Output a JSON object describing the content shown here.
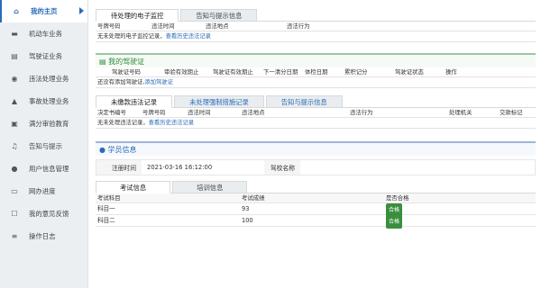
{
  "sidebar": {
    "items": [
      {
        "label": "我的主页",
        "icon": "home-icon",
        "glyph": "⌂",
        "active": true
      },
      {
        "label": "机动车业务",
        "icon": "truck-icon",
        "glyph": "▬"
      },
      {
        "label": "驾驶证业务",
        "icon": "id-card-icon",
        "glyph": "▤"
      },
      {
        "label": "违法处理业务",
        "icon": "camera-icon",
        "glyph": "◉"
      },
      {
        "label": "事故处理业务",
        "icon": "warning-icon",
        "glyph": "▲"
      },
      {
        "label": "满分审验教育",
        "icon": "book-icon",
        "glyph": "▣"
      },
      {
        "label": "告知与提示",
        "icon": "bell-icon",
        "glyph": "♫"
      },
      {
        "label": "用户信息管理",
        "icon": "user-icon",
        "glyph": "●"
      },
      {
        "label": "网办进度",
        "icon": "progress-icon",
        "glyph": "▭"
      },
      {
        "label": "我的意见反馈",
        "icon": "feedback-icon",
        "glyph": "☐"
      },
      {
        "label": "操作日志",
        "icon": "log-icon",
        "glyph": "≡"
      }
    ]
  },
  "section1": {
    "tabs": [
      "待处理的电子监控",
      "告知与提示信息"
    ],
    "columns": [
      "号牌号码",
      "违法时间",
      "违法地点",
      "违法行为"
    ],
    "empty_text": "无未处理的电子监控记录，",
    "link": "查看历史违法记录"
  },
  "license": {
    "title": "我的驾驶证",
    "columns": [
      "驾驶证号码",
      "审验有效期止",
      "驾驶证有效期止",
      "下一清分日期",
      "体检日期",
      "累积记分",
      "驾驶证状态",
      "操作"
    ],
    "empty_text": "还没有添加驾驶证,",
    "link": "添加驾驶证"
  },
  "section3": {
    "tabs": [
      "未缴款违法记录",
      "未处理强制措施记录",
      "告知与提示信息"
    ],
    "columns": [
      "决定书编号",
      "号牌号码",
      "违法时间",
      "违法地点",
      "违法行为",
      "处理机关",
      "交款标记"
    ],
    "empty_text": "无未处理违法记录，",
    "link": "查看历史违法记录"
  },
  "student": {
    "title": "学员信息",
    "reg_label": "注册时间",
    "reg_value": "2021-03-16 16:12:00",
    "school_label": "驾校名称",
    "school_value": "",
    "tabs": [
      "考试信息",
      "培训信息"
    ],
    "columns": [
      "考试科目",
      "考试成绩",
      "是否合格"
    ],
    "rows": [
      {
        "subject": "科目一",
        "score": "93",
        "pass": "合格"
      },
      {
        "subject": "科目二",
        "score": "100",
        "pass": "合格"
      }
    ]
  },
  "colors": {
    "accent": "#2a6bb8",
    "green": "#2f8a3c",
    "badge": "#3a8f3d"
  }
}
